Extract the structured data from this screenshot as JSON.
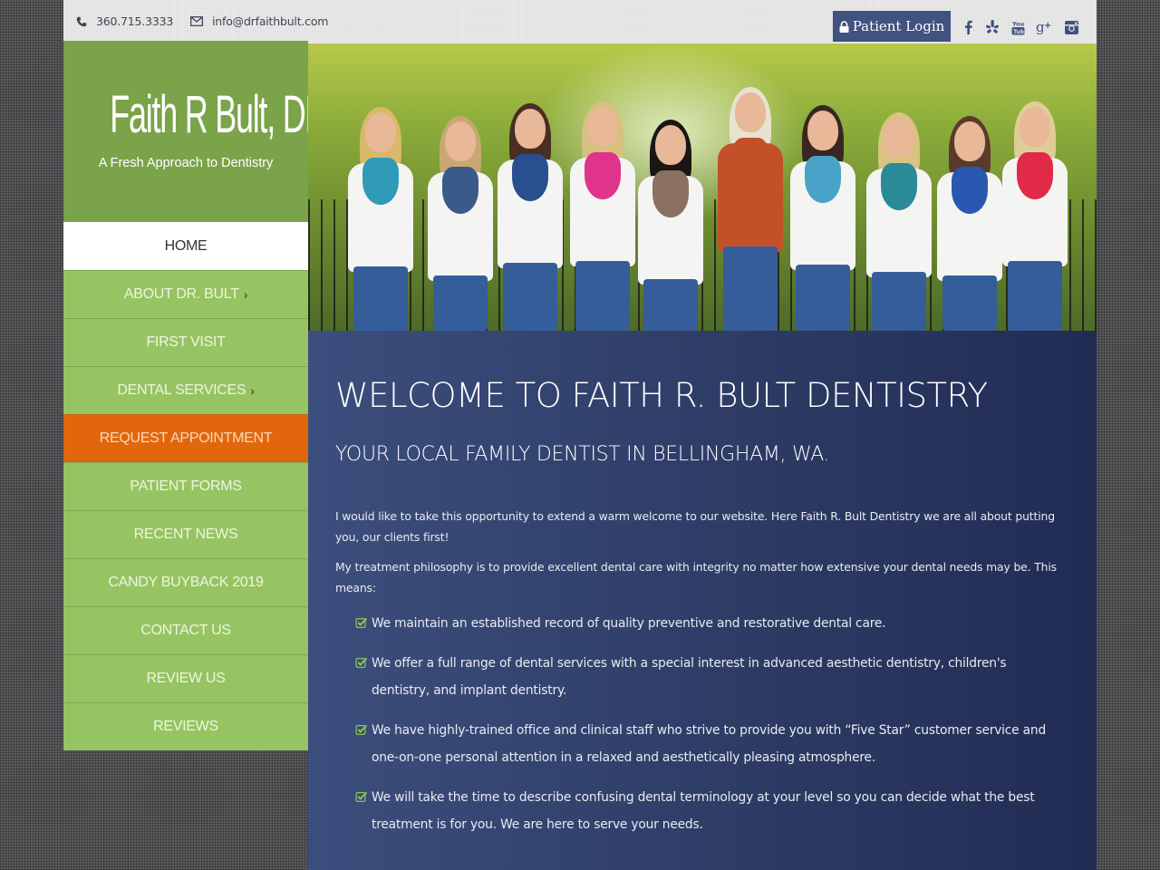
{
  "topbar": {
    "phone": "360.715.3333",
    "email": "info@drfaithbult.com",
    "login_label": "Patient Login",
    "social": [
      "facebook-icon",
      "yelp-icon",
      "youtube-icon",
      "google-plus-icon",
      "instagram-icon"
    ]
  },
  "logo": {
    "title": "Faith R Bult, DDS",
    "tagline": "A Fresh Approach to Dentistry"
  },
  "nav": {
    "items": [
      {
        "label": "HOME",
        "active": true
      },
      {
        "label": "ABOUT DR. BULT",
        "submenu": true
      },
      {
        "label": "FIRST VISIT"
      },
      {
        "label": "DENTAL SERVICES",
        "submenu": true
      },
      {
        "label": "REQUEST APPOINTMENT",
        "highlight": true
      },
      {
        "label": "PATIENT FORMS"
      },
      {
        "label": "RECENT NEWS"
      },
      {
        "label": "CANDY BUYBACK 2019"
      },
      {
        "label": "CONTACT US"
      },
      {
        "label": "REVIEW US"
      },
      {
        "label": "REVIEWS"
      }
    ],
    "submenu_glyph": "›"
  },
  "hero": {
    "alt": "Dental team group photo outdoors"
  },
  "content": {
    "heading": "WELCOME TO FAITH R. BULT DENTISTRY",
    "subheading": "YOUR LOCAL FAMILY DENTIST IN BELLINGHAM, WA.",
    "paragraphs": [
      "I would like to take this opportunity to extend a warm welcome to our website. Here Faith R. Bult Dentistry we are all about putting you, our clients first!",
      "My treatment philosophy is to provide excellent dental care with integrity no matter how extensive your dental needs may be. This means:"
    ],
    "bullets": [
      "We maintain an established record of quality preventive and restorative dental care.",
      "We offer a full range of dental services with a special interest in advanced aesthetic dentistry, children's dentistry, and implant dentistry.",
      "We have highly-trained office and clinical staff who strive to provide you with “Five Star” customer service and one-on-one personal attention in a relaxed and aesthetically pleasing atmosphere.",
      "We will take the time to describe confusing dental terminology at your level so you can decide what the best treatment is for you. We are here to serve your needs."
    ]
  },
  "colors": {
    "green_dark": "#7aa34a",
    "green_nav": "#96c462",
    "orange_cta": "#e2670c",
    "navy": "#2c3a63",
    "login_blue": "#3f5280",
    "check_green": "#8dc452"
  }
}
